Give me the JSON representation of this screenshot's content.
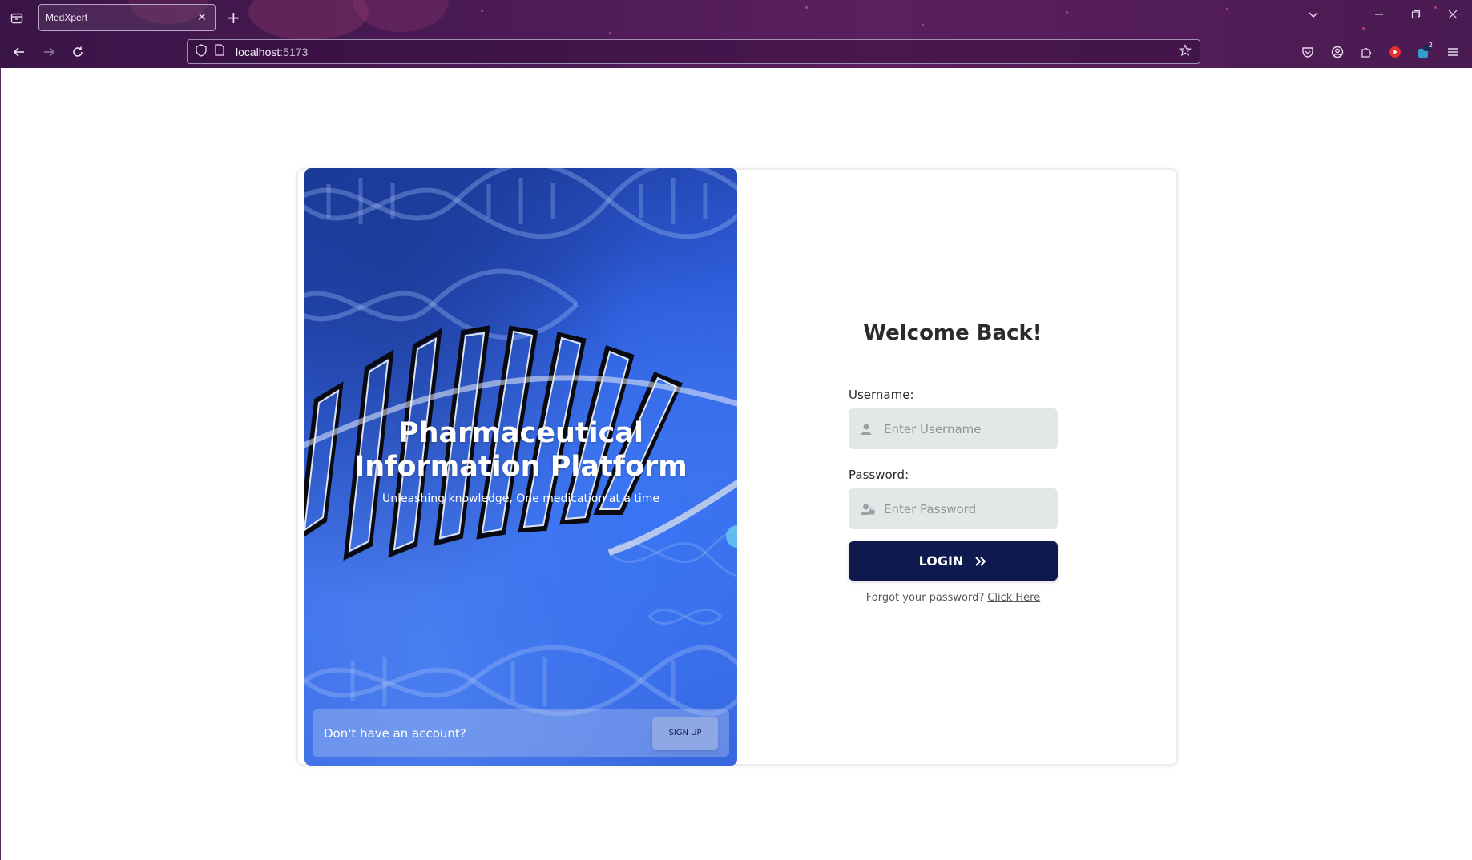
{
  "browser": {
    "tab_title": "MedXpert",
    "url_host": "localhost",
    "url_port": ":5173",
    "extension_badge": "2"
  },
  "hero": {
    "title_line1": "Pharmaceutical",
    "title_line2": "Information Platform",
    "subtitle": "Unleashing knowledge, One medication at a time",
    "signup_prompt": "Don't have an account?",
    "signup_label": "SIGN UP"
  },
  "login": {
    "heading": "Welcome Back!",
    "username_label": "Username:",
    "username_placeholder": "Enter Username",
    "password_label": "Password:",
    "password_placeholder": "Enter Password",
    "login_label": "LOGIN",
    "forgot_text": "Forgot your password?",
    "forgot_link": "Click Here"
  },
  "colors": {
    "chrome_bg": "#4a1a55",
    "hero_blue": "#2d5bd8",
    "login_button": "#0e1a4d",
    "input_bg": "#e4e7e8"
  }
}
